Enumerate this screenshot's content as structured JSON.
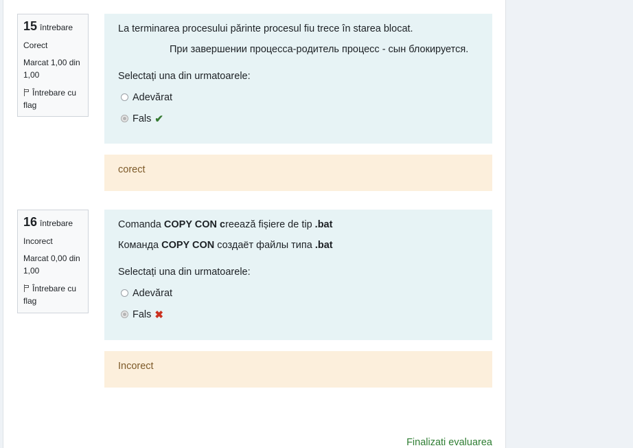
{
  "questions": [
    {
      "number": "15",
      "label": "întrebare",
      "state": "Corect",
      "grade": "Marcat 1,00 din 1,00",
      "flag": "Întrebare cu flag",
      "text_ro": "La terminarea procesului părinte procesul fiu  trece în starea  blocat.",
      "text_ru": "При завершении процесса-родитель процесс - сын блокируется.",
      "prompt": "Selectați una din urmatoarele:",
      "options": [
        {
          "label": "Adevărat",
          "checked": false
        },
        {
          "label": "Fals",
          "checked": true,
          "mark": "✔"
        }
      ],
      "feedback": "corect"
    },
    {
      "number": "16",
      "label": "întrebare",
      "state": "Incorect",
      "grade": "Marcat 0,00 din 1,00",
      "flag": "Întrebare cu flag",
      "text_ro": {
        "a": "Comanda ",
        "b": "COPY CON c",
        "c": "reează fișiere de tip ",
        "d": ".bat"
      },
      "text_ru": {
        "a": "Команда ",
        "b": "COPY CON",
        "c": " создаёт файлы типа ",
        "d": ".bat"
      },
      "prompt": "Selectați una din urmatoarele:",
      "options": [
        {
          "label": "Adevărat",
          "checked": false
        },
        {
          "label": "Fals",
          "checked": true,
          "mark": "✖"
        }
      ],
      "feedback": "Incorect"
    }
  ],
  "footer": {
    "finish_label": "Finalizati evaluarea"
  },
  "colors": {
    "correct": "#357a32",
    "incorrect": "#ca3120",
    "feedback_bg": "#fcefdc",
    "question_bg": "#e7f3f5"
  }
}
